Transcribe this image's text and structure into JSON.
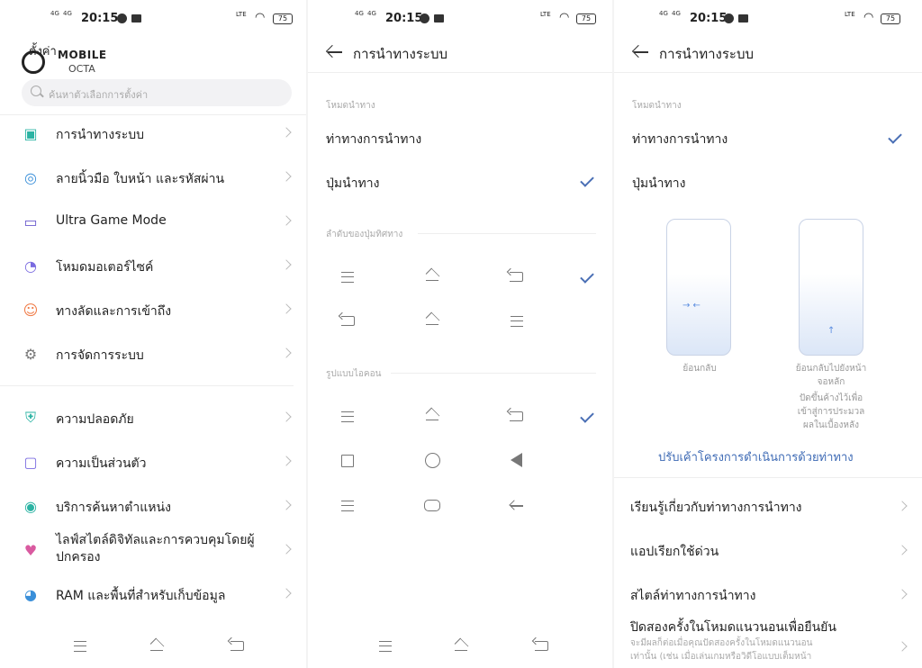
{
  "status_bar": {
    "time": "20:15",
    "net": "4G",
    "lte": "LTE",
    "battery": "75"
  },
  "panel1": {
    "logo_line1": "MOBILE",
    "logo_line2": "OCTA",
    "title_partial": "ตั้งค่า",
    "search_placeholder": "ค้นหาตัวเลือกการตั้งค่า",
    "items_group1": [
      {
        "label": "การนำทางระบบ",
        "icon": "navigation-phone-icon",
        "color": "#2bb3a3"
      },
      {
        "label": "ลายนิ้วมือ ใบหน้า และรหัสผ่าน",
        "icon": "fingerprint-icon",
        "color": "#3a8fd9"
      },
      {
        "label": "Ultra Game Mode",
        "icon": "gamepad-icon",
        "color": "#6a5acd"
      },
      {
        "label": "โหมดมอเตอร์ไซค์",
        "icon": "helmet-icon",
        "color": "#7a6be0"
      },
      {
        "label": "ทางลัดและการเข้าถึง",
        "icon": "accessibility-icon",
        "color": "#f07a45"
      },
      {
        "label": "การจัดการระบบ",
        "icon": "gear-icon",
        "color": "#777777"
      }
    ],
    "items_group2": [
      {
        "label": "ความปลอดภัย",
        "icon": "shield-icon",
        "color": "#2bb3a3"
      },
      {
        "label": "ความเป็นส่วนตัว",
        "icon": "lock-icon",
        "color": "#7a6be0"
      },
      {
        "label": "บริการค้นหาตำแหน่ง",
        "icon": "location-pin-icon",
        "color": "#2bb3a3"
      },
      {
        "label": "ไลฟ์สไตล์ดิจิทัลและการควบคุมโดยผู้ปกครอง",
        "icon": "digital-wellbeing-icon",
        "color": "#d95aa0"
      },
      {
        "label": "RAM และพื้นที่สำหรับเก็บข้อมูล",
        "icon": "pie-chart-icon",
        "color": "#3a8fd9"
      }
    ]
  },
  "panel2": {
    "title": "การนำทางระบบ",
    "section_mode": "โหมดนำทาง",
    "option_gesture": "ท่าทางการนำทาง",
    "option_buttons": "ปุ่มนำทาง",
    "section_order": "ลำดับของปุ่มทิศทาง",
    "section_icon_style": "รูปแบบไอคอน"
  },
  "panel3": {
    "title": "การนำทางระบบ",
    "section_mode": "โหมดนำทาง",
    "option_gesture": "ท่าทางการนำทาง",
    "option_buttons": "ปุ่มนำทาง",
    "caption_back": "ย้อนกลับ",
    "caption_home_1": "ย้อนกลับไปยังหน้า",
    "caption_home_2": "จอหลัก",
    "caption_home_3": "ปัดขึ้นค้างไว้เพื่อ",
    "caption_home_4": "เข้าสู่การประมวล",
    "caption_home_5": "ผลในเบื้องหลัง",
    "customize_link": "ปรับเค้าโครงการดำเนินการด้วยท่าทาง",
    "learn": "เรียนรู้เกี่ยวกับท่าทางการนำทาง",
    "quick_app": "แอปเรียกใช้ด่วน",
    "gesture_style": "สไตล์ท่าทางการนำทาง",
    "double_swipe": "ปิดสองครั้งในโหมดแนวนอนเพื่อยืนยัน",
    "double_swipe_sub_1": "จะมีผลก็ต่อเมื่อคุณปัดสองครั้งในโหมดแนวนอน",
    "double_swipe_sub_2": "เท่านั้น (เช่น เมื่อเล่นเกมหรือวิดีโอแบบเต็มหน้า"
  }
}
